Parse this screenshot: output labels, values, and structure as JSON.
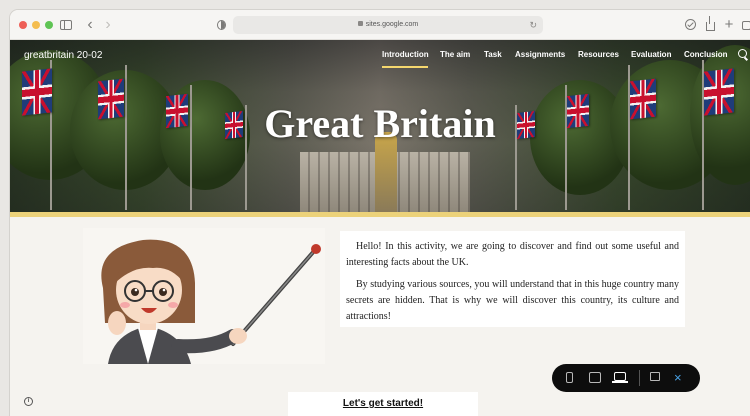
{
  "browser": {
    "url": "sites.google.com"
  },
  "site": {
    "name": "greatbritain 20-02",
    "nav": [
      {
        "label": "Introduction",
        "active": true
      },
      {
        "label": "The aim",
        "active": false
      },
      {
        "label": "Task",
        "active": false
      },
      {
        "label": "Assignments",
        "active": false
      },
      {
        "label": "Resources",
        "active": false
      },
      {
        "label": "Evaluation",
        "active": false
      },
      {
        "label": "Conclusion",
        "active": false
      }
    ],
    "hero_title": "Great Britain",
    "accent_color": "#ecd27a"
  },
  "content": {
    "paragraphs": [
      "Hello! In this activity, we are going to discover and find out some useful and interesting facts about the UK.",
      "By studying various sources, you will understand that in this huge country many secrets are hidden. That is why we will discover this country, its culture and attractions!"
    ],
    "cta_label": "Let's get started!"
  },
  "icons": {
    "info": "i",
    "close": "×"
  }
}
